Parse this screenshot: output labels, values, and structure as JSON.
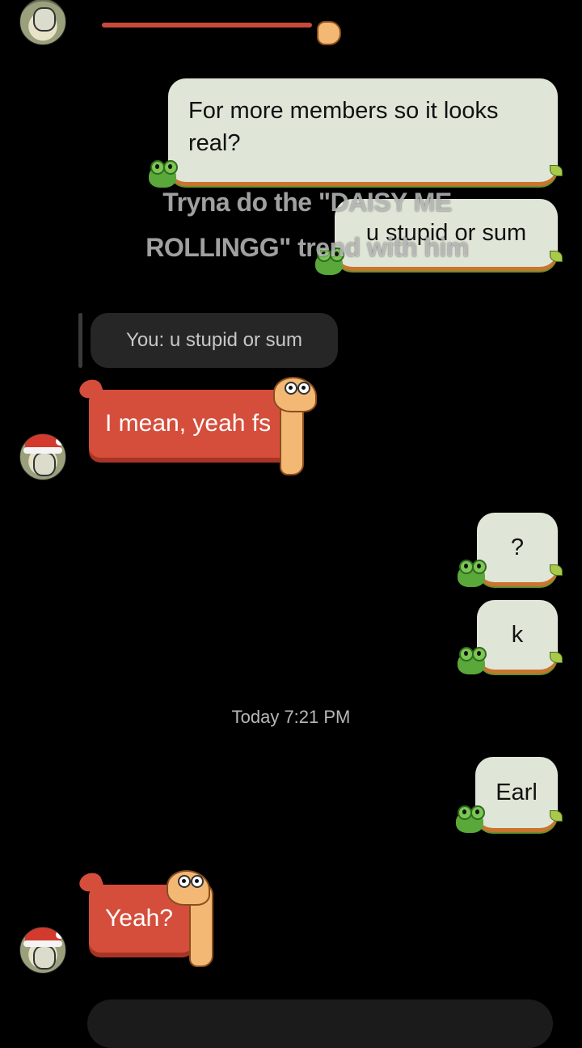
{
  "caption": "Tryna do the \"DAISY ME ROLLINGG\" trend with him",
  "messages": {
    "sent_1": "For more members so it looks real?",
    "sent_2": "u stupid or sum",
    "reply_preview": "You: u stupid or sum",
    "recv_1": "I mean, yeah fs",
    "sent_3": "?",
    "sent_4": "k",
    "timestamp": "Today 7:21 PM",
    "sent_5": "Earl",
    "recv_2": "Yeah?"
  },
  "colors": {
    "background": "#000000",
    "sent_bubble": "#dfe6d7",
    "recv_bubble": "#d44e3b",
    "reply_bubble": "#262626"
  }
}
